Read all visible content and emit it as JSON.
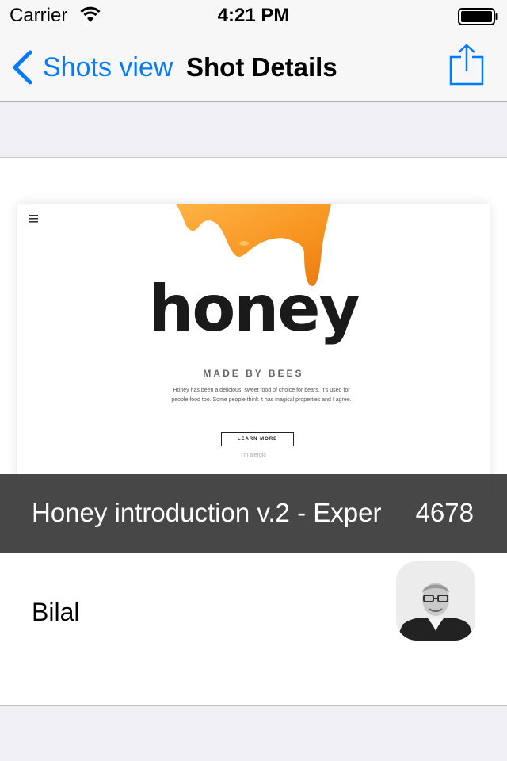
{
  "status_bar": {
    "carrier": "Carrier",
    "time": "4:21 PM"
  },
  "nav": {
    "back_label": "Shots view",
    "title": "Shot Details",
    "accent_color": "#007aff",
    "share_icon": "share-icon"
  },
  "shot": {
    "preview": {
      "headline": "honey",
      "tagline": "MADE BY BEES",
      "description": "Honey has been a delicious, sweet food of choice for bears. It's used for people food too. Some people think it has magical properties and I agree.",
      "cta_label": "LEARN MORE",
      "secondary_link": "I'm alergic"
    },
    "title": "Honey introduction v.2 - Exper",
    "count": "4678"
  },
  "author": {
    "name": "Bilal"
  }
}
